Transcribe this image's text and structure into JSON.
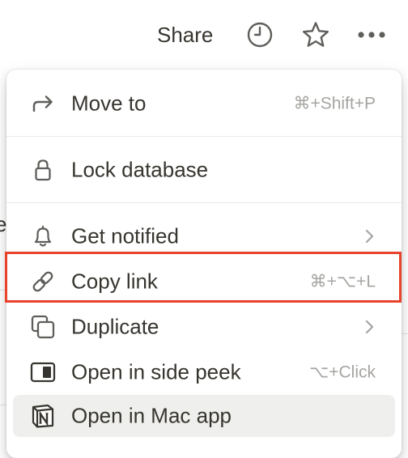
{
  "topbar": {
    "share_label": "Share",
    "icons": [
      "clock-icon",
      "star-icon",
      "more-icon"
    ]
  },
  "background": {
    "partial_letter": "e"
  },
  "menu": {
    "items": [
      {
        "label": "Move to",
        "icon": "arrow-turn-right-icon",
        "shortcut": "⌘+Shift+P"
      },
      {
        "label": "Lock database",
        "icon": "lock-icon"
      },
      {
        "label": "Get notified",
        "icon": "bell-icon",
        "submenu": true
      },
      {
        "label": "Copy link",
        "icon": "link-icon",
        "shortcut": "⌘+⌥+L",
        "highlighted": true
      },
      {
        "label": "Duplicate",
        "icon": "duplicate-icon",
        "submenu": true
      },
      {
        "label": "Open in side peek",
        "icon": "side-peek-icon",
        "shortcut": "⌥+Click"
      },
      {
        "label": "Open in Mac app",
        "icon": "notion-logo-icon",
        "hovered": true
      }
    ]
  },
  "colors": {
    "text": "#37352f",
    "muted": "#a6a5a2",
    "icon": "#5f5e5b",
    "hover_bg": "#efefed",
    "highlight_border": "#e8432d"
  }
}
